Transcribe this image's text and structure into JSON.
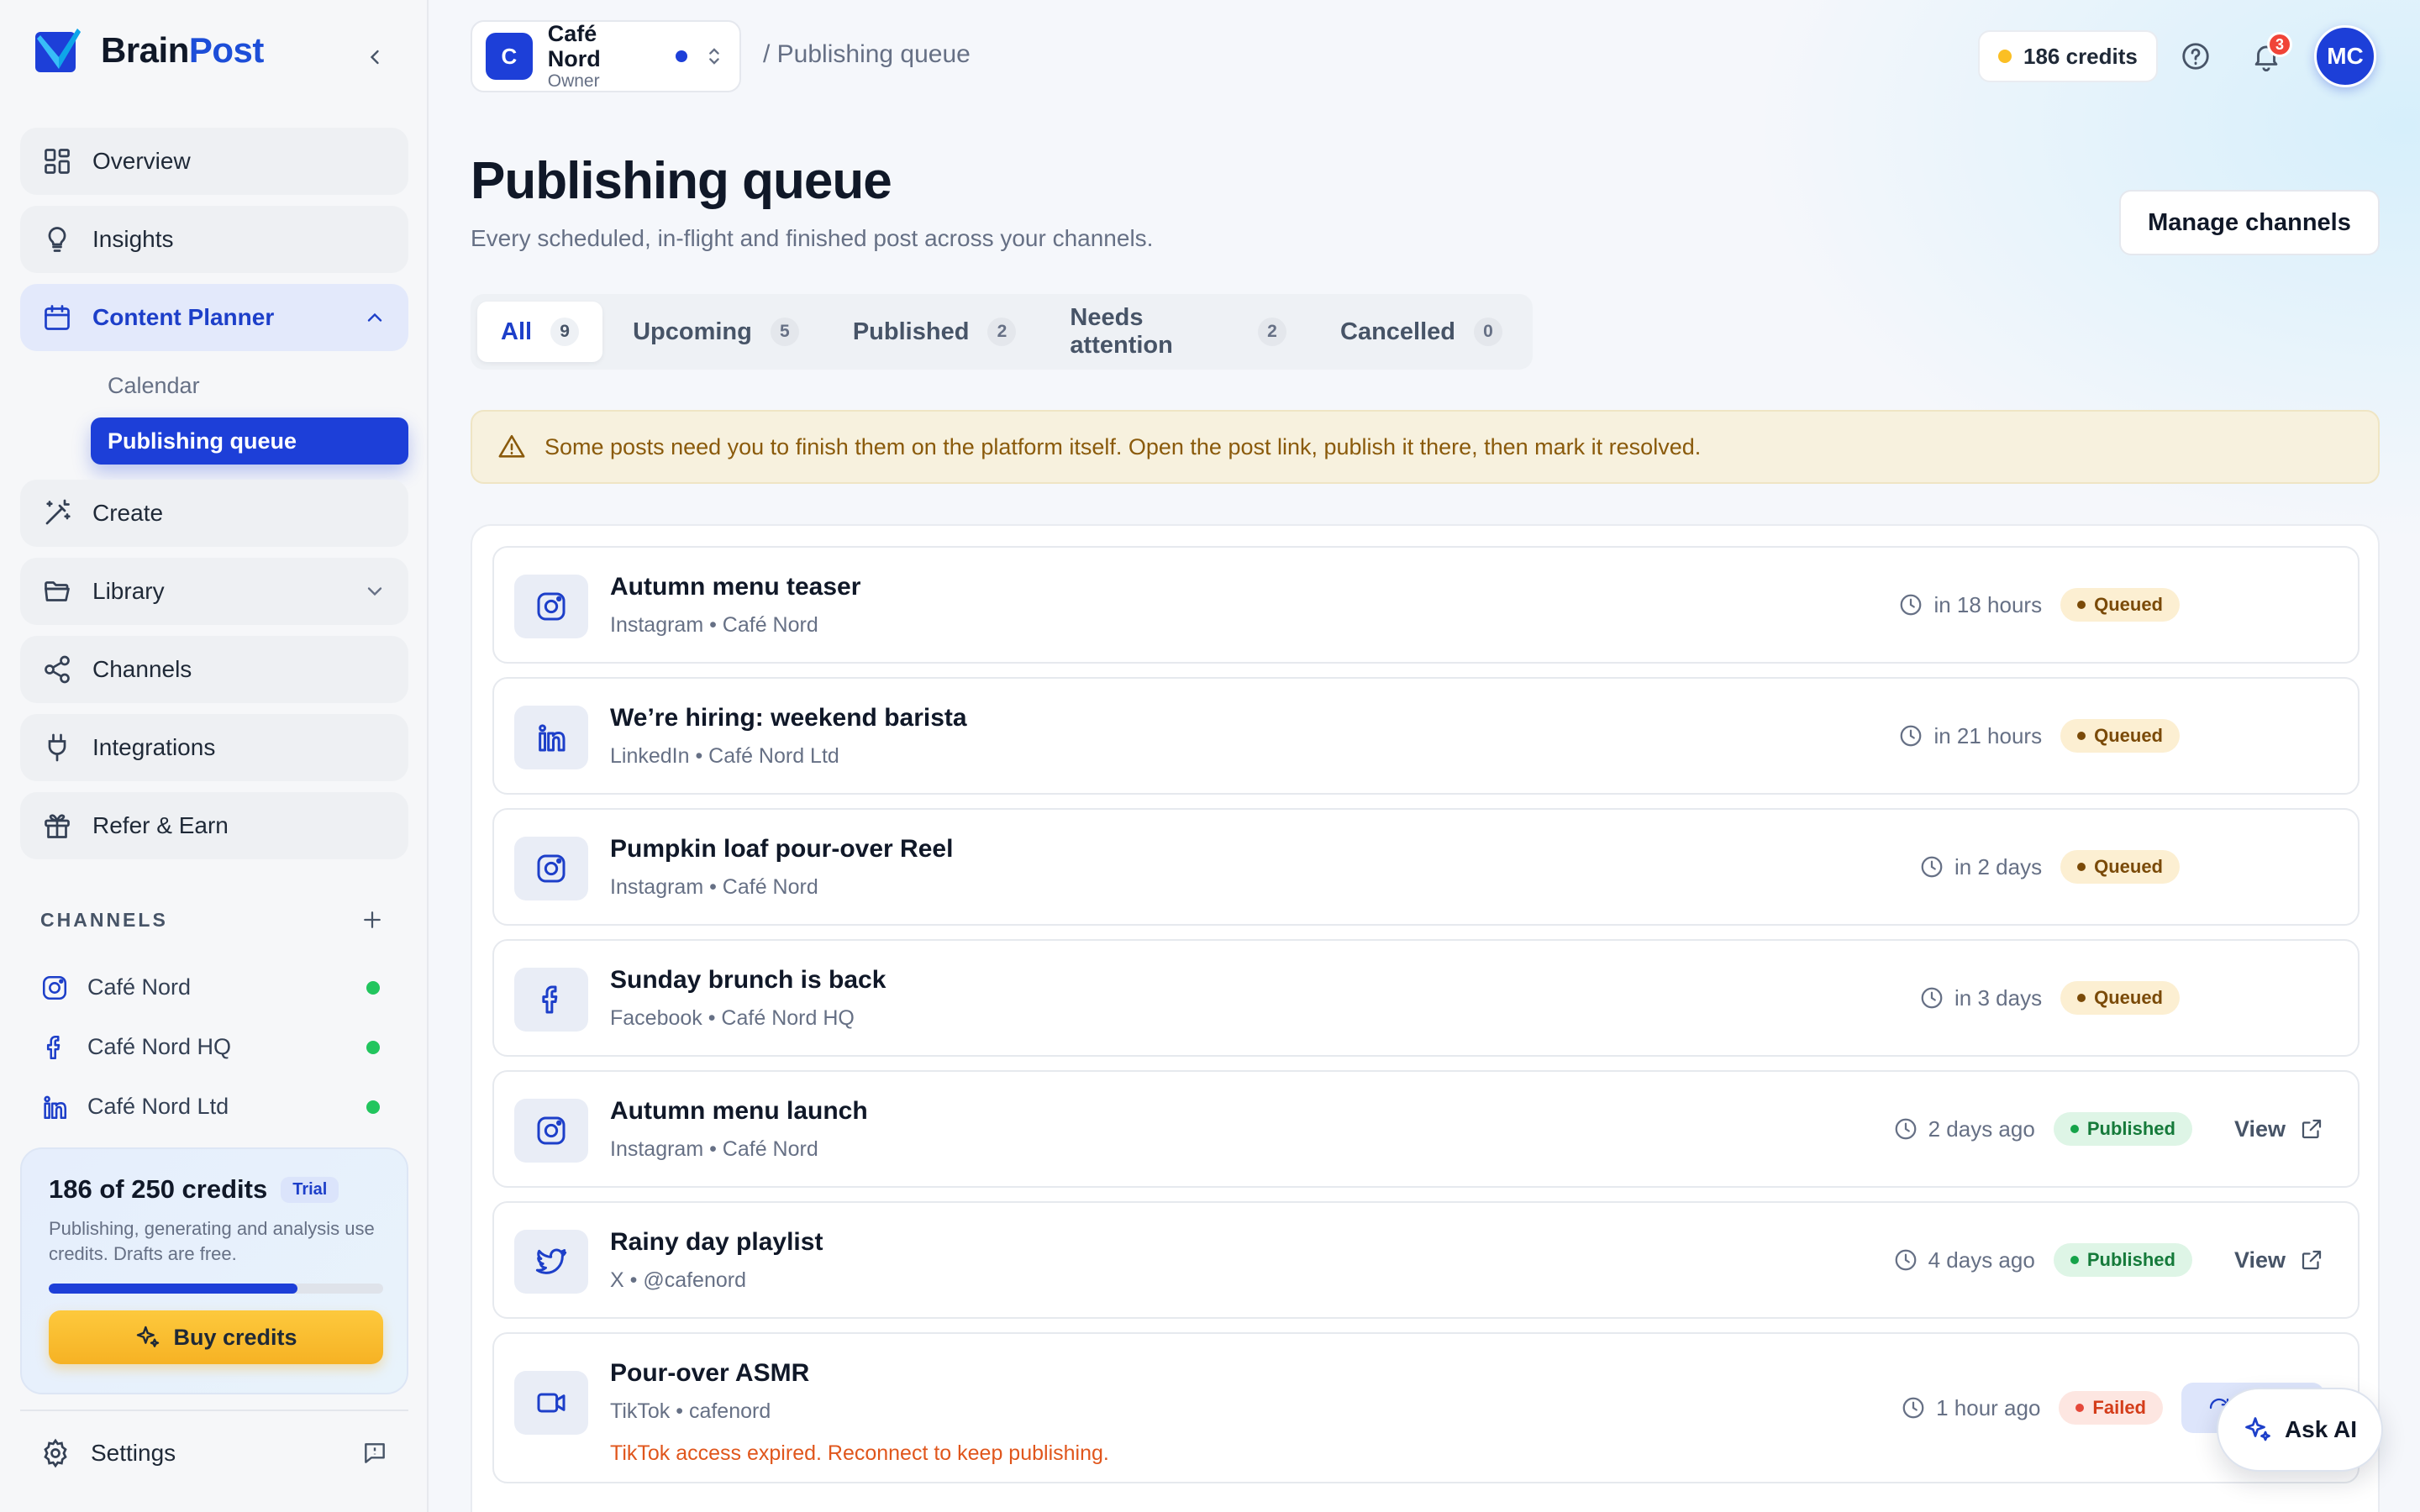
{
  "brand": {
    "name_part1": "Brain",
    "name_part2": "Post"
  },
  "sidebar": {
    "nav": [
      {
        "label": "Overview",
        "icon": "grid-icon"
      },
      {
        "label": "Insights",
        "icon": "lightbulb-icon"
      },
      {
        "label": "Content Planner",
        "icon": "calendar-icon"
      },
      {
        "label": "Create",
        "icon": "magic-wand-icon"
      },
      {
        "label": "Library",
        "icon": "folder-icon"
      },
      {
        "label": "Channels",
        "icon": "share-nodes-icon"
      },
      {
        "label": "Integrations",
        "icon": "plug-icon"
      },
      {
        "label": "Refer & Earn",
        "icon": "gift-icon"
      }
    ],
    "subnav": [
      {
        "label": "Calendar"
      },
      {
        "label": "Publishing queue"
      }
    ],
    "channels_title": "CHANNELS",
    "channels": [
      {
        "label": "Café Nord",
        "icon": "instagram-icon"
      },
      {
        "label": "Café Nord HQ",
        "icon": "facebook-icon"
      },
      {
        "label": "Café Nord Ltd",
        "icon": "linkedin-icon"
      }
    ],
    "credits_card": {
      "title": "186 of 250 credits",
      "badge": "Trial",
      "description": "Publishing, generating and analysis use credits. Drafts are free.",
      "used": 186,
      "total": 250,
      "button": "Buy credits"
    },
    "settings_label": "Settings"
  },
  "header": {
    "workspace": {
      "initial": "C",
      "name": "Café Nord",
      "role": "Owner"
    },
    "breadcrumb": "/ Publishing queue",
    "credits": "186 credits",
    "notification_count": "3",
    "user_initials": "MC"
  },
  "page": {
    "title": "Publishing queue",
    "subtitle": "Every scheduled, in-flight and finished post across your channels.",
    "manage_button": "Manage channels"
  },
  "tabs": [
    {
      "label": "All",
      "count": "9"
    },
    {
      "label": "Upcoming",
      "count": "5"
    },
    {
      "label": "Published",
      "count": "2"
    },
    {
      "label": "Needs attention",
      "count": "2"
    },
    {
      "label": "Cancelled",
      "count": "0"
    }
  ],
  "notice": "Some posts need you to finish them on the platform itself. Open the post link, publish it there, then mark it resolved.",
  "posts": [
    {
      "title": "Autumn menu teaser",
      "meta": "Instagram • Café Nord",
      "time": "in 18 hours",
      "status": "Queued",
      "icon": "instagram-icon"
    },
    {
      "title": "We’re hiring: weekend barista",
      "meta": "LinkedIn • Café Nord Ltd",
      "time": "in 21 hours",
      "status": "Queued",
      "icon": "linkedin-icon"
    },
    {
      "title": "Pumpkin loaf pour-over Reel",
      "meta": "Instagram • Café Nord",
      "time": "in 2 days",
      "status": "Queued",
      "icon": "instagram-icon"
    },
    {
      "title": "Sunday brunch is back",
      "meta": "Facebook • Café Nord HQ",
      "time": "in 3 days",
      "status": "Queued",
      "icon": "facebook-icon"
    },
    {
      "title": "Autumn menu launch",
      "meta": "Instagram • Café Nord",
      "time": "2 days ago",
      "status": "Published",
      "action": "View",
      "icon": "instagram-icon"
    },
    {
      "title": "Rainy day playlist",
      "meta": "X • @cafenord",
      "time": "4 days ago",
      "status": "Published",
      "action": "View",
      "icon": "twitter-icon"
    },
    {
      "title": "Pour-over ASMR",
      "meta": "TikTok • cafenord",
      "time": "1 hour ago",
      "status": "Failed",
      "error": "TikTok access expired. Reconnect to keep publishing.",
      "icon": "video-icon"
    }
  ],
  "ask_ai": "Ask AI",
  "colors": {
    "accent": "#1d3fd8",
    "queued": "#fcefd2",
    "published": "#def5e6",
    "failed": "#fde6e1",
    "credits_button": "#f6b224"
  }
}
